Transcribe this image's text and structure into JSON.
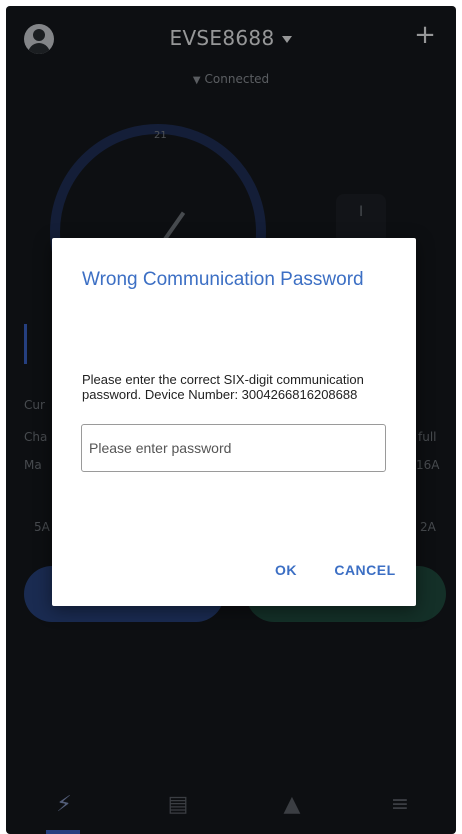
{
  "header": {
    "device_name": "EVSE8688",
    "status": "Connected",
    "add_label": "+"
  },
  "background": {
    "gauge_tick": "21",
    "side_panel_text": "I",
    "left_text_1": "Cur",
    "left_text_2": "Cha",
    "left_text_3": "Ma",
    "left_text_4": "5A",
    "right_text_1": "full",
    "right_text_2": "16A",
    "right_text_3": "2A"
  },
  "dialog": {
    "title": "Wrong Communication Password",
    "message": "Please enter the correct SIX-digit communication password. Device Number:  3004266816208688",
    "input_value": "",
    "input_placeholder": "Please enter password",
    "ok_label": "OK",
    "cancel_label": "CANCEL"
  },
  "icons": {
    "avatar": "user-avatar-icon",
    "wifi": "wifi-icon",
    "nav": [
      "lightning-icon",
      "schedule-icon",
      "bell-icon",
      "menu-icon"
    ]
  },
  "colors": {
    "app_background": "#15181c",
    "accent_blue": "#3c6fc4",
    "dialog_background": "#ffffff"
  }
}
